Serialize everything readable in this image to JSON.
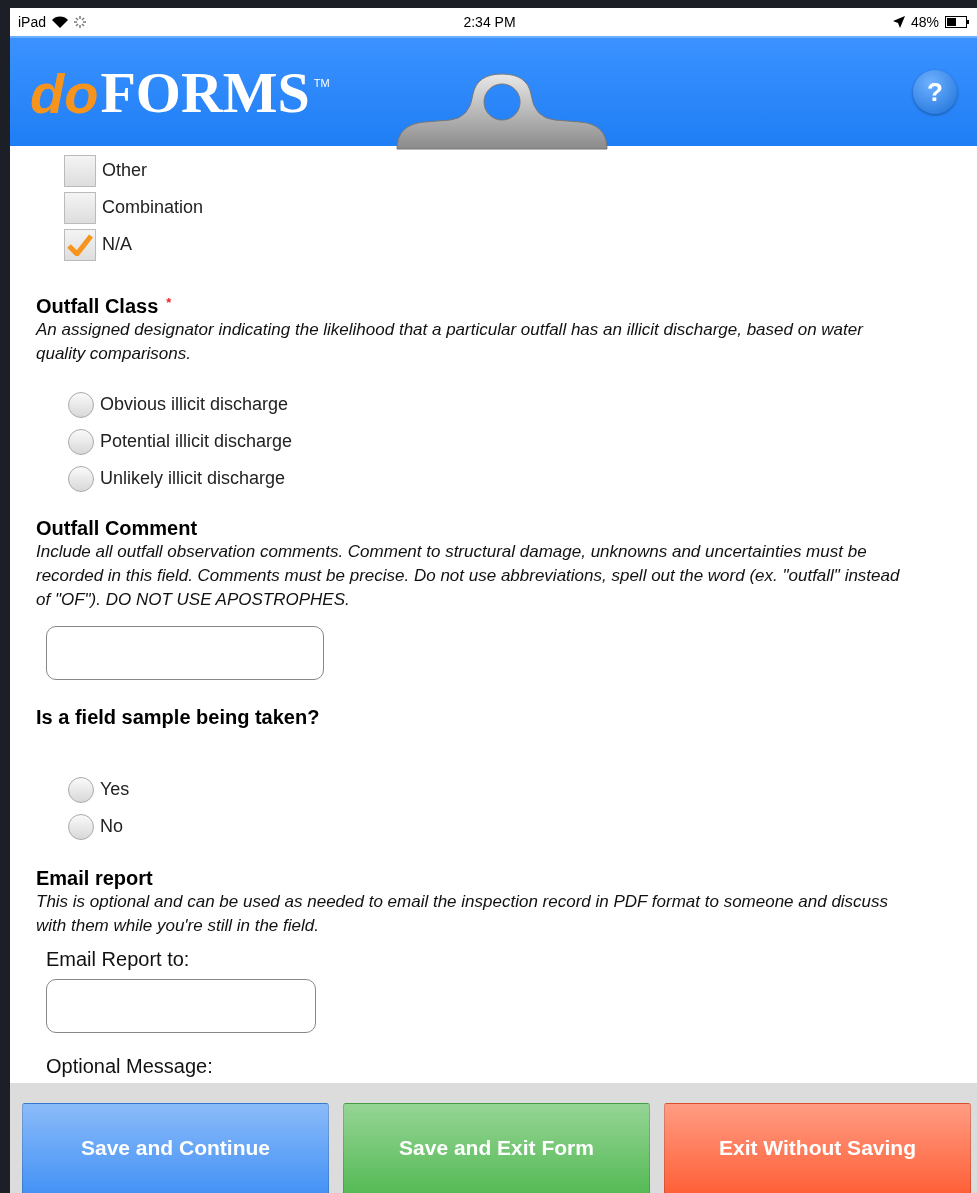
{
  "status_bar": {
    "device": "iPad",
    "time": "2:34 PM",
    "battery": "48%"
  },
  "header": {
    "logo_do": "do",
    "logo_forms": "FORMS",
    "logo_tm": "TM",
    "help": "?"
  },
  "checkboxes": [
    {
      "label": "Other",
      "checked": false
    },
    {
      "label": "Combination",
      "checked": false
    },
    {
      "label": "N/A",
      "checked": true
    }
  ],
  "outfall_class": {
    "title": "Outfall Class",
    "required_mark": "*",
    "description": "An assigned designator indicating the likelihood that a particular outfall has an illicit discharge, based on water quality comparisons.",
    "options": [
      {
        "label": "Obvious illicit discharge",
        "selected": false
      },
      {
        "label": "Potential illicit discharge",
        "selected": false
      },
      {
        "label": "Unlikely illicit discharge",
        "selected": false
      }
    ]
  },
  "outfall_comment": {
    "title": "Outfall Comment",
    "description": "Include all outfall observation comments. Comment to structural damage, unknowns and uncertainties must be recorded in this field. Comments must be precise. Do not use abbreviations, spell out the word (ex. \"outfall\" instead of \"OF\"). DO NOT USE APOSTROPHES."
  },
  "field_sample": {
    "title": "Is a field sample being taken?",
    "options": [
      {
        "label": "Yes",
        "selected": false
      },
      {
        "label": "No",
        "selected": false
      }
    ]
  },
  "email_report": {
    "title": "Email report",
    "description": "This is optional and can be used as needed to email the inspection record in PDF format to someone and discuss with them while you're still in the field.",
    "to_label": "Email Report to:",
    "message_label": "Optional Message:"
  },
  "buttons": [
    {
      "label": "Save and Continue",
      "color": "#3d8ef5"
    },
    {
      "label": "Save and Exit Form",
      "color": "#4fb84f"
    },
    {
      "label": "Exit Without Saving",
      "color": "#ff5a30"
    }
  ]
}
